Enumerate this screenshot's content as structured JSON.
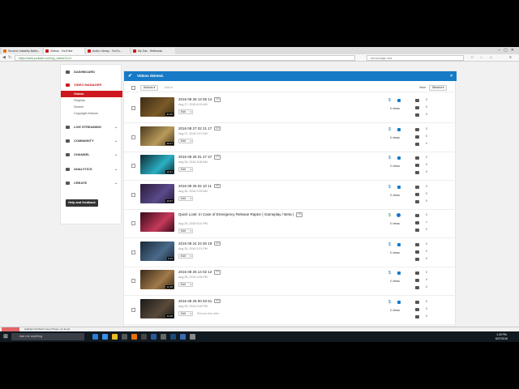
{
  "browser": {
    "tabs": [
      {
        "label": "Survivor Instantly Baths -",
        "color": "#e8710a"
      },
      {
        "label": "Videos - YouTube",
        "color": "#cc181e",
        "active": true
      },
      {
        "label": "Audio Library - YouTu...",
        "color": "#cc181e"
      },
      {
        "label": "My Gav - Bethesda",
        "color": "#cc181e"
      }
    ],
    "url": "https://www.youtube.com/my_videos?o=U",
    "search_placeholder": "arrival lodge new"
  },
  "sidebar": {
    "dashboard": "DASHBOARD",
    "video_manager": "VIDEO MANAGER",
    "subitems": [
      "Videos",
      "Playlists",
      "Search",
      "Copyright Notices"
    ],
    "live_streaming": "LIVE STREAMING",
    "community": "COMMUNITY",
    "channel": "CHANNEL",
    "analytics": "ANALYTICS",
    "create": "CREATE",
    "help": "Help and feedback"
  },
  "banner": {
    "text": "Videos deleted.",
    "close": "×"
  },
  "toolbar": {
    "actions": "Actions",
    "add_to": "Add to",
    "view": "View:",
    "view_value": "Newest"
  },
  "videos": [
    {
      "title": "2016 08 26 13 05 14",
      "date": "Aug 27, 2016 6:23 AM",
      "duration": "31:06",
      "views": "0 views",
      "stats": [
        "0",
        "0",
        "0"
      ],
      "icon": "lock",
      "colors": [
        "#3c2a14",
        "#7a5a28"
      ]
    },
    {
      "title": "2016 08 27 02 21 17",
      "date": "Aug 27, 2016 2:47 AM",
      "duration": "29:17",
      "views": "0 views",
      "stats": [
        "0",
        "0",
        "0"
      ],
      "icon": "lock",
      "colors": [
        "#4a3a1e",
        "#b89a5a"
      ]
    },
    {
      "title": "2016 08 26 01 47 47",
      "date": "Aug 26, 2016 3:08 AM",
      "duration": "20:31",
      "views": "0 views",
      "stats": [
        "0",
        "0",
        "0"
      ],
      "icon": "lock",
      "colors": [
        "#0e2a33",
        "#2ab0c4"
      ]
    },
    {
      "title": "2016 08 26 02 10 11",
      "date": "Aug 26, 2016 2:29 AM",
      "duration": "20:57",
      "views": "0 views",
      "stats": [
        "0",
        "0",
        "0"
      ],
      "icon": "lock",
      "colors": [
        "#2a1a3a",
        "#5a4a8a"
      ]
    },
    {
      "title": "Quick Look: In Case of Emergency Release Raptor ( Gameplay / Beta )",
      "date": "Aug 25, 2016 6:31 PM",
      "duration": "",
      "views": "0 views",
      "stats": [
        "0",
        "1",
        "0"
      ],
      "icon": "globe",
      "colors": [
        "#3a0a1a",
        "#c43a5a"
      ]
    },
    {
      "title": "2016 08 24 22 00 19",
      "date": "Aug 25, 2016 3:21 PM",
      "duration": "9:15",
      "views": "0 views",
      "stats": [
        "0",
        "0",
        "0"
      ],
      "icon": "lock",
      "colors": [
        "#1a2a3a",
        "#4a6a8a"
      ]
    },
    {
      "title": "2016 08 25 14 02 12",
      "date": "Aug 25, 2016 3:04 PM",
      "duration": "22:48",
      "views": "0 views",
      "stats": [
        "0",
        "0",
        "0"
      ],
      "icon": "lock",
      "colors": [
        "#3a2a1a",
        "#a07a4a"
      ]
    },
    {
      "title": "2016 08 25 00 03 51",
      "date": "Aug 25, 2016 2:45 PM",
      "duration": "23:48",
      "views": "0 views",
      "stats": [
        "0",
        "0",
        "0"
      ],
      "icon": "lock",
      "colors": [
        "#1a1a1a",
        "#5a4a3a"
      ],
      "remove": "Remove this video"
    }
  ],
  "edit_label": "Edit",
  "taskbar": {
    "search": "Ask me anything",
    "time": "1:49 PM",
    "date": "8/27/2016",
    "findbar": "Highlight All   Match Case   Phrase not found"
  }
}
